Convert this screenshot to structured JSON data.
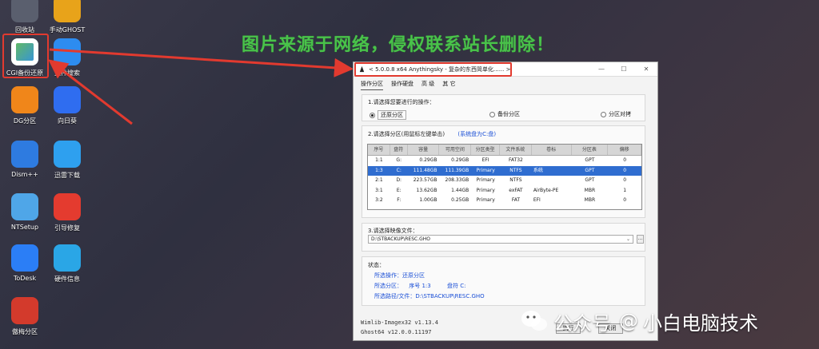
{
  "desktop": {
    "icons": [
      {
        "label": "回收站",
        "icon": "recycle-bin-icon",
        "color": "#5a5f6e"
      },
      {
        "label": "手动GHOST",
        "icon": "ghost-icon",
        "color": "#e8a31a"
      },
      {
        "label": "CGI备份还原",
        "icon": "cgi-backup-icon",
        "color": "#ffffff"
      },
      {
        "label": "文件搜索",
        "icon": "file-search-icon",
        "color": "#2d8cf0"
      },
      {
        "label": "DG分区",
        "icon": "dg-partition-icon",
        "color": "#f0861a"
      },
      {
        "label": "向日葵",
        "icon": "sunflower-icon",
        "color": "#2f6df0"
      },
      {
        "label": "Dism++",
        "icon": "dism-icon",
        "color": "#2e7be0"
      },
      {
        "label": "迅雷下载",
        "icon": "thunder-icon",
        "color": "#2ea0ef"
      },
      {
        "label": "NTSetup",
        "icon": "ntsetup-icon",
        "color": "#4fa6e8"
      },
      {
        "label": "引导修复",
        "icon": "boot-repair-icon",
        "color": "#e43b2f"
      },
      {
        "label": "ToDesk",
        "icon": "todesk-icon",
        "color": "#2b7ef6"
      },
      {
        "label": "硬件信息",
        "icon": "hardware-info-icon",
        "color": "#2aa6e6"
      },
      {
        "label": "傲梅分区",
        "icon": "aomei-partition-icon",
        "color": "#d33a2c"
      }
    ]
  },
  "watermark": {
    "text": "图片来源于网络，侵权联系站长删除！",
    "color": "#49c24a"
  },
  "wechat": {
    "prefix": "公众号",
    "at": "@",
    "account": "小白电脑技术",
    "ghost": "小白电脑技术"
  },
  "window": {
    "title": "< 5.0.0.8 x64 Anythingsky - 复杂的东西简单化...... >",
    "controls": {
      "minimize": "—",
      "maximize": "☐",
      "close": "✕"
    },
    "menu": [
      "操作分区",
      "操作硬盘",
      "高 级",
      "其 它"
    ],
    "section1": {
      "title": "1.请选择您要进行的操作：",
      "options": [
        "还原分区",
        "备份分区",
        "分区对拷"
      ],
      "selected": 0
    },
    "section2": {
      "title": "2.请选择分区(用鼠标左键单击)",
      "hint": "(系统盘为C:盘)",
      "columns": [
        "序号",
        "盘符",
        "容量",
        "可用空间",
        "分区类型",
        "文件系统",
        "卷标",
        "分区表",
        "偏移"
      ],
      "rows": [
        [
          "1:1",
          "G:",
          "0.29GB",
          "0.29GB",
          "EFI",
          "FAT32",
          "",
          "GPT",
          "0"
        ],
        [
          "1:3",
          "C:",
          "111.48GB",
          "111.39GB",
          "Primary",
          "NTFS",
          "系统",
          "GPT",
          "0"
        ],
        [
          "2:1",
          "D:",
          "223.57GB",
          "208.33GB",
          "Primary",
          "NTFS",
          "",
          "GPT",
          "0"
        ],
        [
          "3:1",
          "E:",
          "13.62GB",
          "1.44GB",
          "Primary",
          "exFAT",
          "AirByte-PE",
          "MBR",
          "1"
        ],
        [
          "3:2",
          "F:",
          "1.00GB",
          "0.25GB",
          "Primary",
          "FAT",
          "EFI",
          "MBR",
          "0"
        ]
      ],
      "selected_row": 1
    },
    "section3": {
      "title": "3.请选择映像文件：",
      "path": "D:\\STBACKUP\\RESC.GHO",
      "browse": "..."
    },
    "status": {
      "title": "状态：",
      "operation": "所选操作：还原分区",
      "partition_label": "所选分区：",
      "seq": "序号 1:3",
      "drive": "盘符 C:",
      "path": "所选路径/文件：D:\\STBACKUP\\RESC.GHO"
    },
    "versions": [
      "Wimlib-Imagex32 v1.13.4",
      "Ghost64 v12.0.0.11197"
    ],
    "buttons": {
      "execute": "执行",
      "close": "关闭"
    }
  }
}
